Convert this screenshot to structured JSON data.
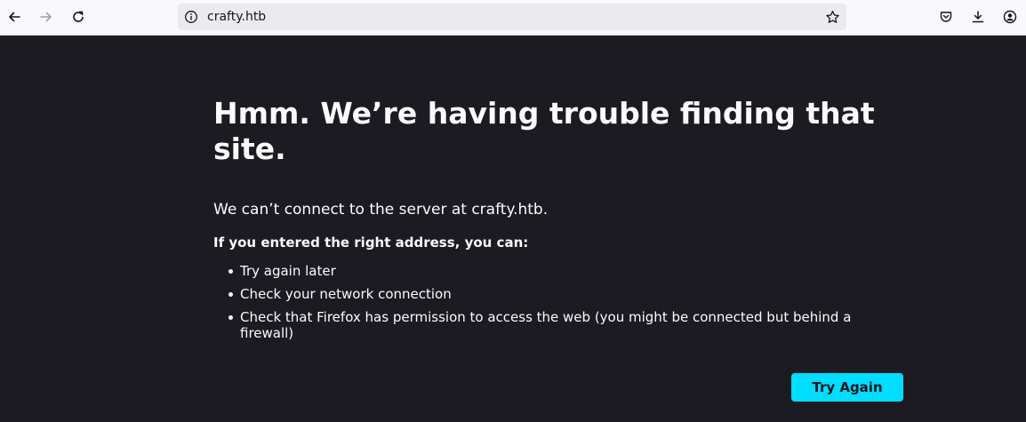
{
  "browser": {
    "url": "crafty.htb",
    "icons": {
      "back": "back-arrow-icon",
      "forward": "forward-arrow-icon",
      "reload": "reload-icon",
      "site_info": "info-icon",
      "bookmark": "star-icon",
      "pocket": "pocket-icon",
      "downloads": "download-icon",
      "account": "account-icon"
    }
  },
  "error_page": {
    "title": "Hmm. We’re having trouble finding that site.",
    "description": "We can’t connect to the server at crafty.htb.",
    "advice_heading": "If you entered the right address, you can:",
    "suggestions": [
      "Try again later",
      "Check your network connection",
      "Check that Firefox has permission to access the web (you might be connected but behind a firewall)"
    ],
    "try_again_label": "Try Again"
  },
  "colors": {
    "page_background": "#1c1b22",
    "toolbar_background": "#f9f9fb",
    "button_accent": "#00ddff",
    "text": "#fbfbfe"
  }
}
